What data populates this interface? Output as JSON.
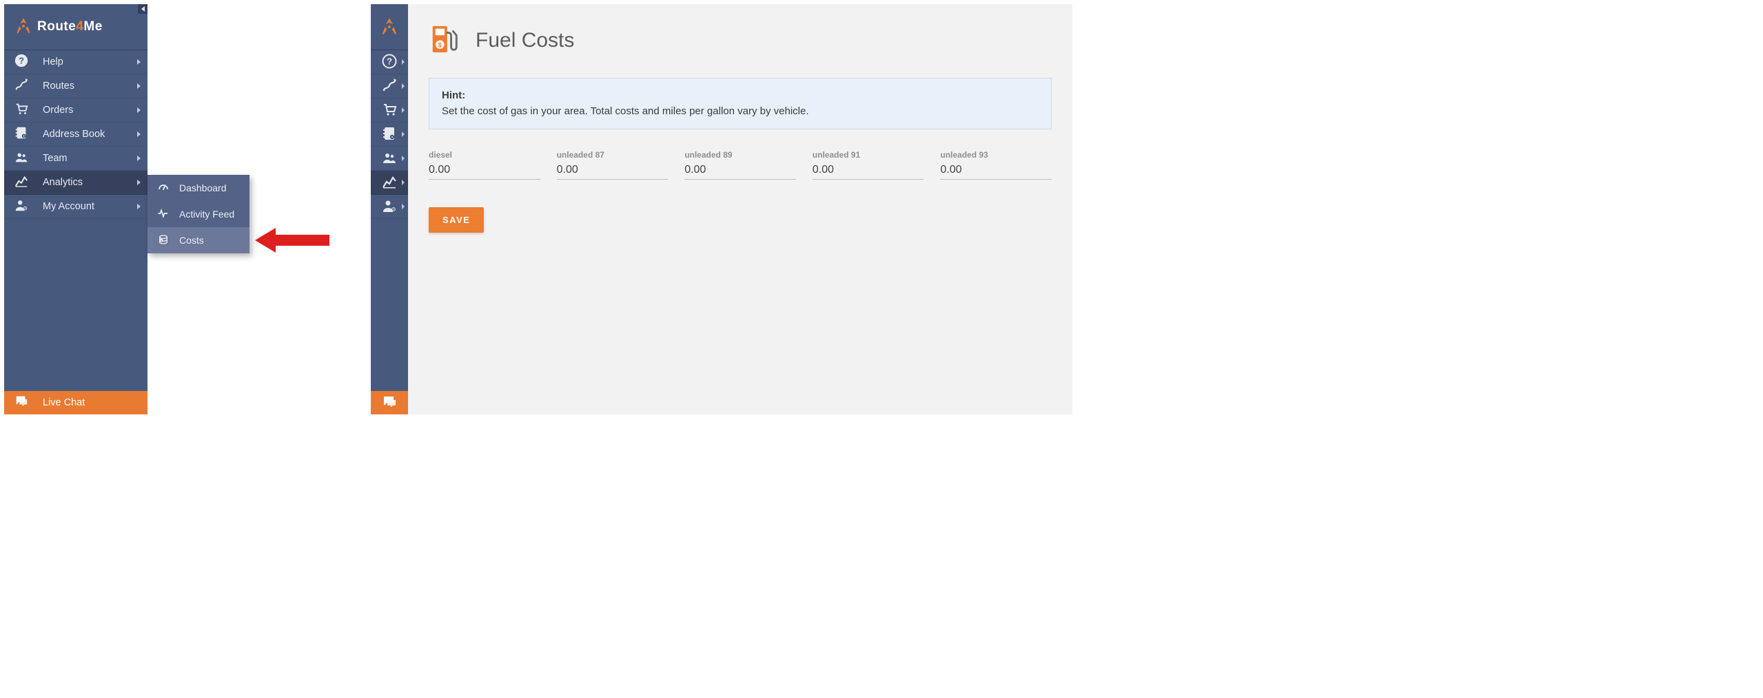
{
  "brand": {
    "part1": "Route",
    "part2": "4",
    "part3": "Me"
  },
  "nav": {
    "items": [
      {
        "id": "help",
        "label": "Help"
      },
      {
        "id": "routes",
        "label": "Routes"
      },
      {
        "id": "orders",
        "label": "Orders"
      },
      {
        "id": "addressbook",
        "label": "Address Book"
      },
      {
        "id": "team",
        "label": "Team"
      },
      {
        "id": "analytics",
        "label": "Analytics"
      },
      {
        "id": "myaccount",
        "label": "My Account"
      }
    ],
    "live_chat": "Live Chat"
  },
  "submenu": {
    "items": [
      {
        "id": "dashboard",
        "label": "Dashboard"
      },
      {
        "id": "activityfeed",
        "label": "Activity Feed"
      },
      {
        "id": "costs",
        "label": "Costs"
      }
    ]
  },
  "page": {
    "title": "Fuel Costs",
    "hint_title": "Hint:",
    "hint_body": "Set the cost of gas in your area. Total costs and miles per gallon vary by vehicle.",
    "fields": [
      {
        "id": "diesel",
        "label": "diesel",
        "value": "0.00"
      },
      {
        "id": "unleaded87",
        "label": "unleaded 87",
        "value": "0.00"
      },
      {
        "id": "unleaded89",
        "label": "unleaded 89",
        "value": "0.00"
      },
      {
        "id": "unleaded91",
        "label": "unleaded 91",
        "value": "0.00"
      },
      {
        "id": "unleaded93",
        "label": "unleaded 93",
        "value": "0.00"
      }
    ],
    "save_label": "SAVE"
  },
  "colors": {
    "accent": "#ed7d31",
    "nav": "#48597e",
    "annotation_arrow": "#dd1f1f"
  }
}
